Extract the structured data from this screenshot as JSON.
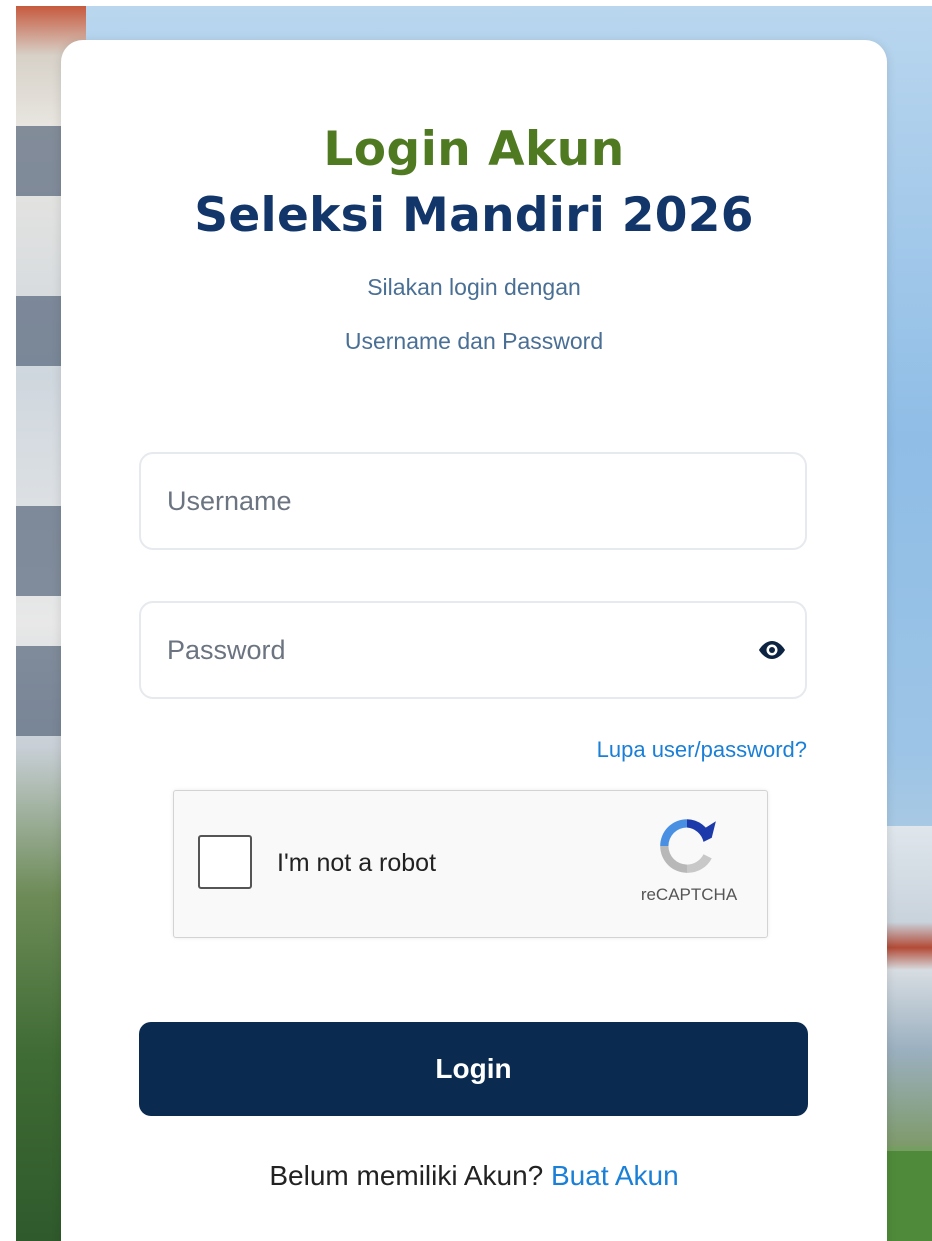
{
  "header": {
    "title_line1": "Login Akun",
    "title_line2": "Seleksi Mandiri 2026",
    "subtitle_line1": "Silakan login dengan",
    "subtitle_line2": "Username dan Password"
  },
  "form": {
    "username_placeholder": "Username",
    "username_value": "",
    "password_placeholder": "Password",
    "password_value": "",
    "forgot_link": "Lupa user/password?",
    "login_button": "Login"
  },
  "captcha": {
    "label": "I'm not a robot",
    "brand": "reCAPTCHA",
    "checked": false
  },
  "footer": {
    "prompt": "Belum memiliki Akun? ",
    "register_link": "Buat Akun"
  },
  "colors": {
    "title_green": "#4f7a21",
    "title_navy": "#12366a",
    "button_navy": "#0a2a4f",
    "link_blue": "#1a7fd6"
  },
  "icons": {
    "password_toggle": "eye-icon",
    "captcha_logo": "recaptcha-logo-icon"
  }
}
